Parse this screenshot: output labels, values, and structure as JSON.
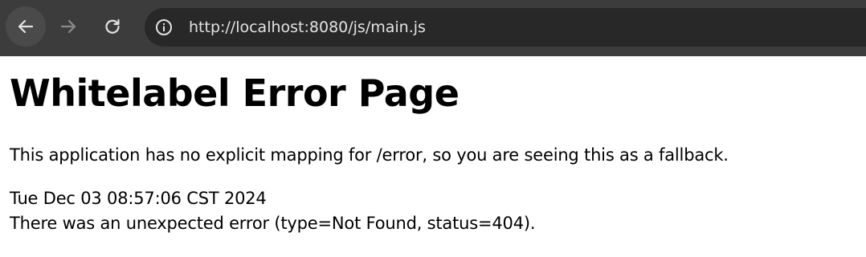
{
  "browser": {
    "url": "http://localhost:8080/js/main.js",
    "icons": {
      "back": "arrow-left-icon",
      "forward": "arrow-right-icon",
      "reload": "reload-icon",
      "site_info": "info-icon"
    },
    "colors": {
      "toolbar": "#3c3c3c",
      "omnibox": "#282828",
      "url_text": "#e3e3e3"
    }
  },
  "page": {
    "title": "Whitelabel Error Page",
    "message": "This application has no explicit mapping for /error, so you are seeing this as a fallback.",
    "timestamp": "Tue Dec 03 08:57:06 CST 2024",
    "error_detail": "There was an unexpected error (type=Not Found, status=404)."
  }
}
